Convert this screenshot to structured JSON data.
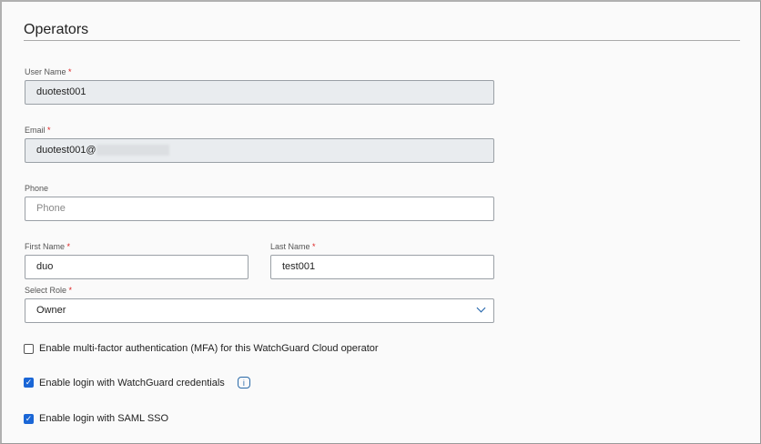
{
  "title": "Operators",
  "username": {
    "label": "User Name",
    "required": "*",
    "value": "duotest001"
  },
  "email": {
    "label": "Email",
    "required": "*",
    "value": "duotest001@"
  },
  "phone": {
    "label": "Phone",
    "placeholder": "Phone"
  },
  "first_name": {
    "label": "First Name",
    "required": "*",
    "value": "duo"
  },
  "last_name": {
    "label": "Last Name",
    "required": "*",
    "value": "test001"
  },
  "role": {
    "label": "Select Role",
    "required": "*",
    "value": "Owner"
  },
  "checkboxes": [
    {
      "label": "Enable multi-factor authentication (MFA) for this WatchGuard Cloud operator",
      "checked": false
    },
    {
      "label": "Enable login with WatchGuard credentials",
      "checked": true
    },
    {
      "label": "Enable login with SAML SSO",
      "checked": true
    }
  ],
  "info_icon": "i"
}
